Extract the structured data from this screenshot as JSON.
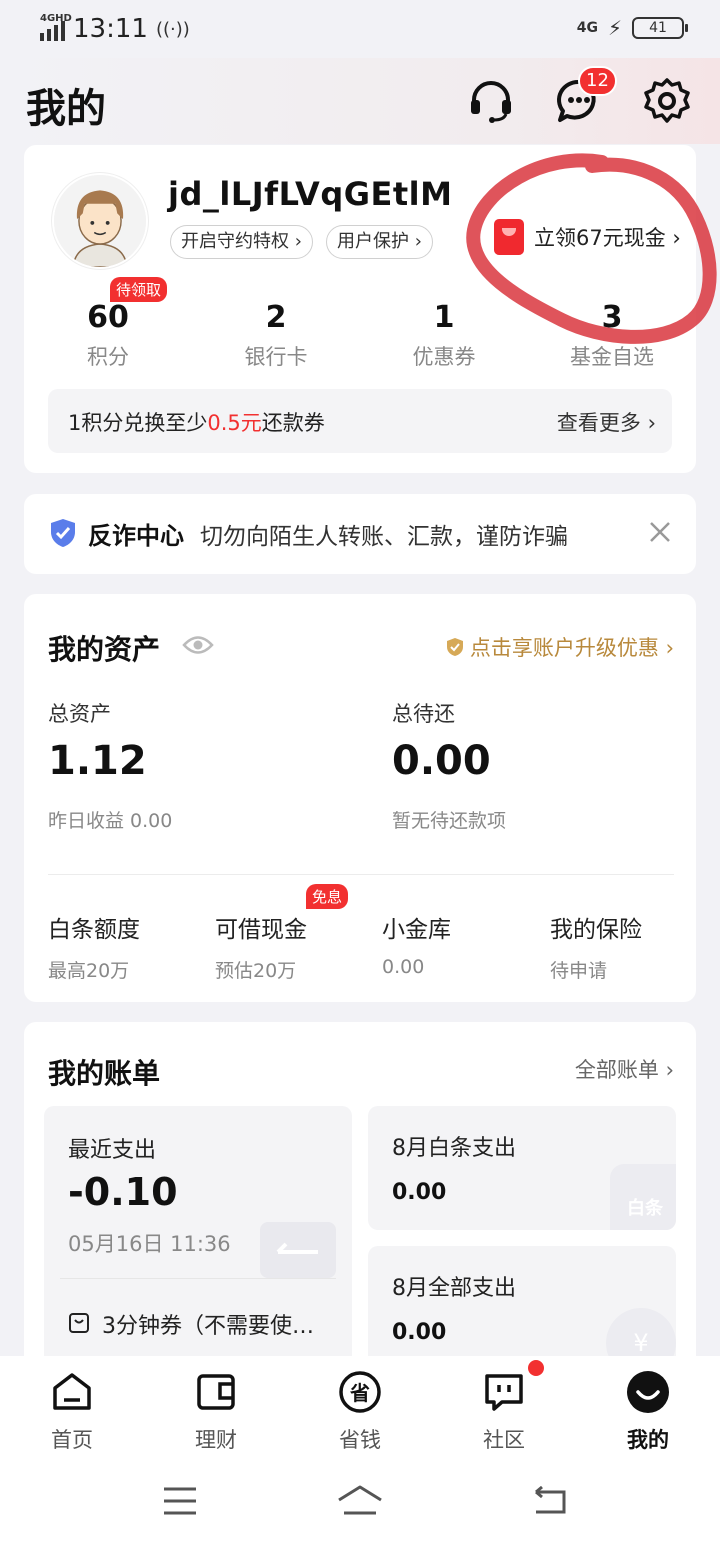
{
  "status": {
    "network": "4GHD",
    "time": "13:11",
    "right_network": "4G",
    "battery": "41"
  },
  "header": {
    "title": "我的",
    "message_count": "12"
  },
  "profile": {
    "username": "jd_lLJfLVqGEtlM",
    "chips": [
      "开启守约特权 ›",
      "用户保护 ›"
    ],
    "cash_offer": "立领67元现金 ›",
    "stats": [
      {
        "value": "60",
        "label": "积分",
        "tag": "待领取"
      },
      {
        "value": "2",
        "label": "银行卡"
      },
      {
        "value": "1",
        "label": "优惠券"
      },
      {
        "value": "3",
        "label": "基金自选"
      }
    ],
    "points_text_prefix": "1积分兑换至少",
    "points_text_highlight": "0.5元",
    "points_text_suffix": "还款券",
    "more": "查看更多 ›"
  },
  "fraud": {
    "title": "反诈中心",
    "message": "切勿向陌生人转账、汇款，谨防诈骗"
  },
  "assets": {
    "title": "我的资产",
    "upgrade": "点击享账户升级优惠 ›",
    "total_label": "总资产",
    "total_value": "1.12",
    "yesterday": "昨日收益 0.00",
    "repay_label": "总待还",
    "repay_value": "0.00",
    "repay_note": "暂无待还款项",
    "quick": [
      {
        "title": "白条额度",
        "sub": "最高20万"
      },
      {
        "title": "可借现金",
        "sub": "预估20万",
        "tag": "免息"
      },
      {
        "title": "小金库",
        "sub": "0.00"
      },
      {
        "title": "我的保险",
        "sub": "待申请"
      }
    ]
  },
  "bills": {
    "title": "我的账单",
    "all": "全部账单 ›",
    "recent_label": "最近支出",
    "recent_value": "-0.10",
    "recent_date": "05月16日 11:36",
    "recent_item": "3分钟券（不需要使…",
    "baitiao_label": "8月白条支出",
    "baitiao_value": "0.00",
    "baitiao_icon": "白条",
    "all_label": "8月全部支出",
    "all_value": "0.00",
    "yen_icon": "¥"
  },
  "nav": [
    {
      "label": "首页",
      "icon": "home-icon"
    },
    {
      "label": "理财",
      "icon": "wallet-icon"
    },
    {
      "label": "省钱",
      "icon": "save-money-icon"
    },
    {
      "label": "社区",
      "icon": "chat-icon"
    },
    {
      "label": "我的",
      "icon": "profile-face-icon"
    }
  ],
  "colors": {
    "accent_red": "#f23030",
    "gold": "#b8893c",
    "annotation": "#d9363e"
  }
}
